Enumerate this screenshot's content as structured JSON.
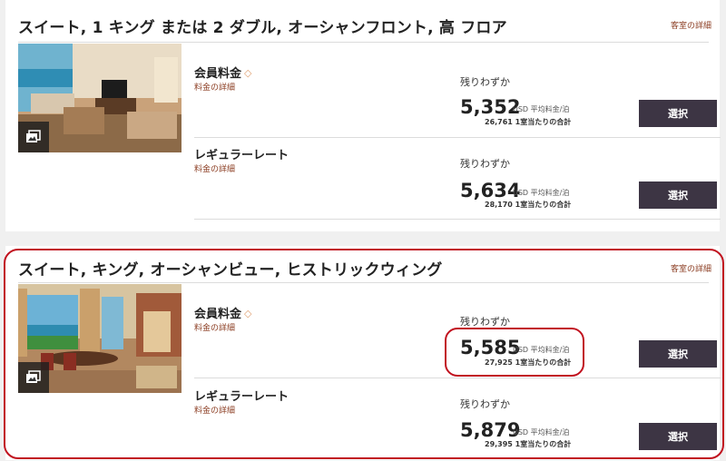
{
  "rooms": [
    {
      "title": "スイート, 1 キング または 2 ダブル, オーシャンフロント, 高 フロア",
      "details_link": "客室の詳細",
      "rates": [
        {
          "name": "会員料金",
          "link": "料金の詳細",
          "availability": "残りわずか",
          "price": "5,352",
          "per_night": "USD 平均料金/泊",
          "total": "26,761 1室当たりの合計",
          "button": "選択"
        },
        {
          "name": "レギュラーレート",
          "link": "料金の詳細",
          "availability": "残りわずか",
          "price": "5,634",
          "per_night": "USD 平均料金/泊",
          "total": "28,170 1室当たりの合計",
          "button": "選択"
        }
      ]
    },
    {
      "title": "スイート, キング, オーシャンビュー, ヒストリックウィング",
      "details_link": "客室の詳細",
      "rates": [
        {
          "name": "会員料金",
          "link": "料金の詳細",
          "availability": "残りわずか",
          "price": "5,585",
          "per_night": "USD 平均料金/泊",
          "total": "27,925 1室当たりの合計",
          "button": "選択"
        },
        {
          "name": "レギュラーレート",
          "link": "料金の詳細",
          "availability": "残りわずか",
          "price": "5,879",
          "per_night": "USD 平均料金/泊",
          "total": "29,395 1室当たりの合計",
          "button": "選択"
        }
      ]
    }
  ],
  "colors": {
    "button_bg": "#3d3544",
    "link": "#8a3b20",
    "highlight": "#c1121f"
  },
  "icons": {
    "member_tag": "tag-icon",
    "photo_badge": "gallery-icon"
  }
}
